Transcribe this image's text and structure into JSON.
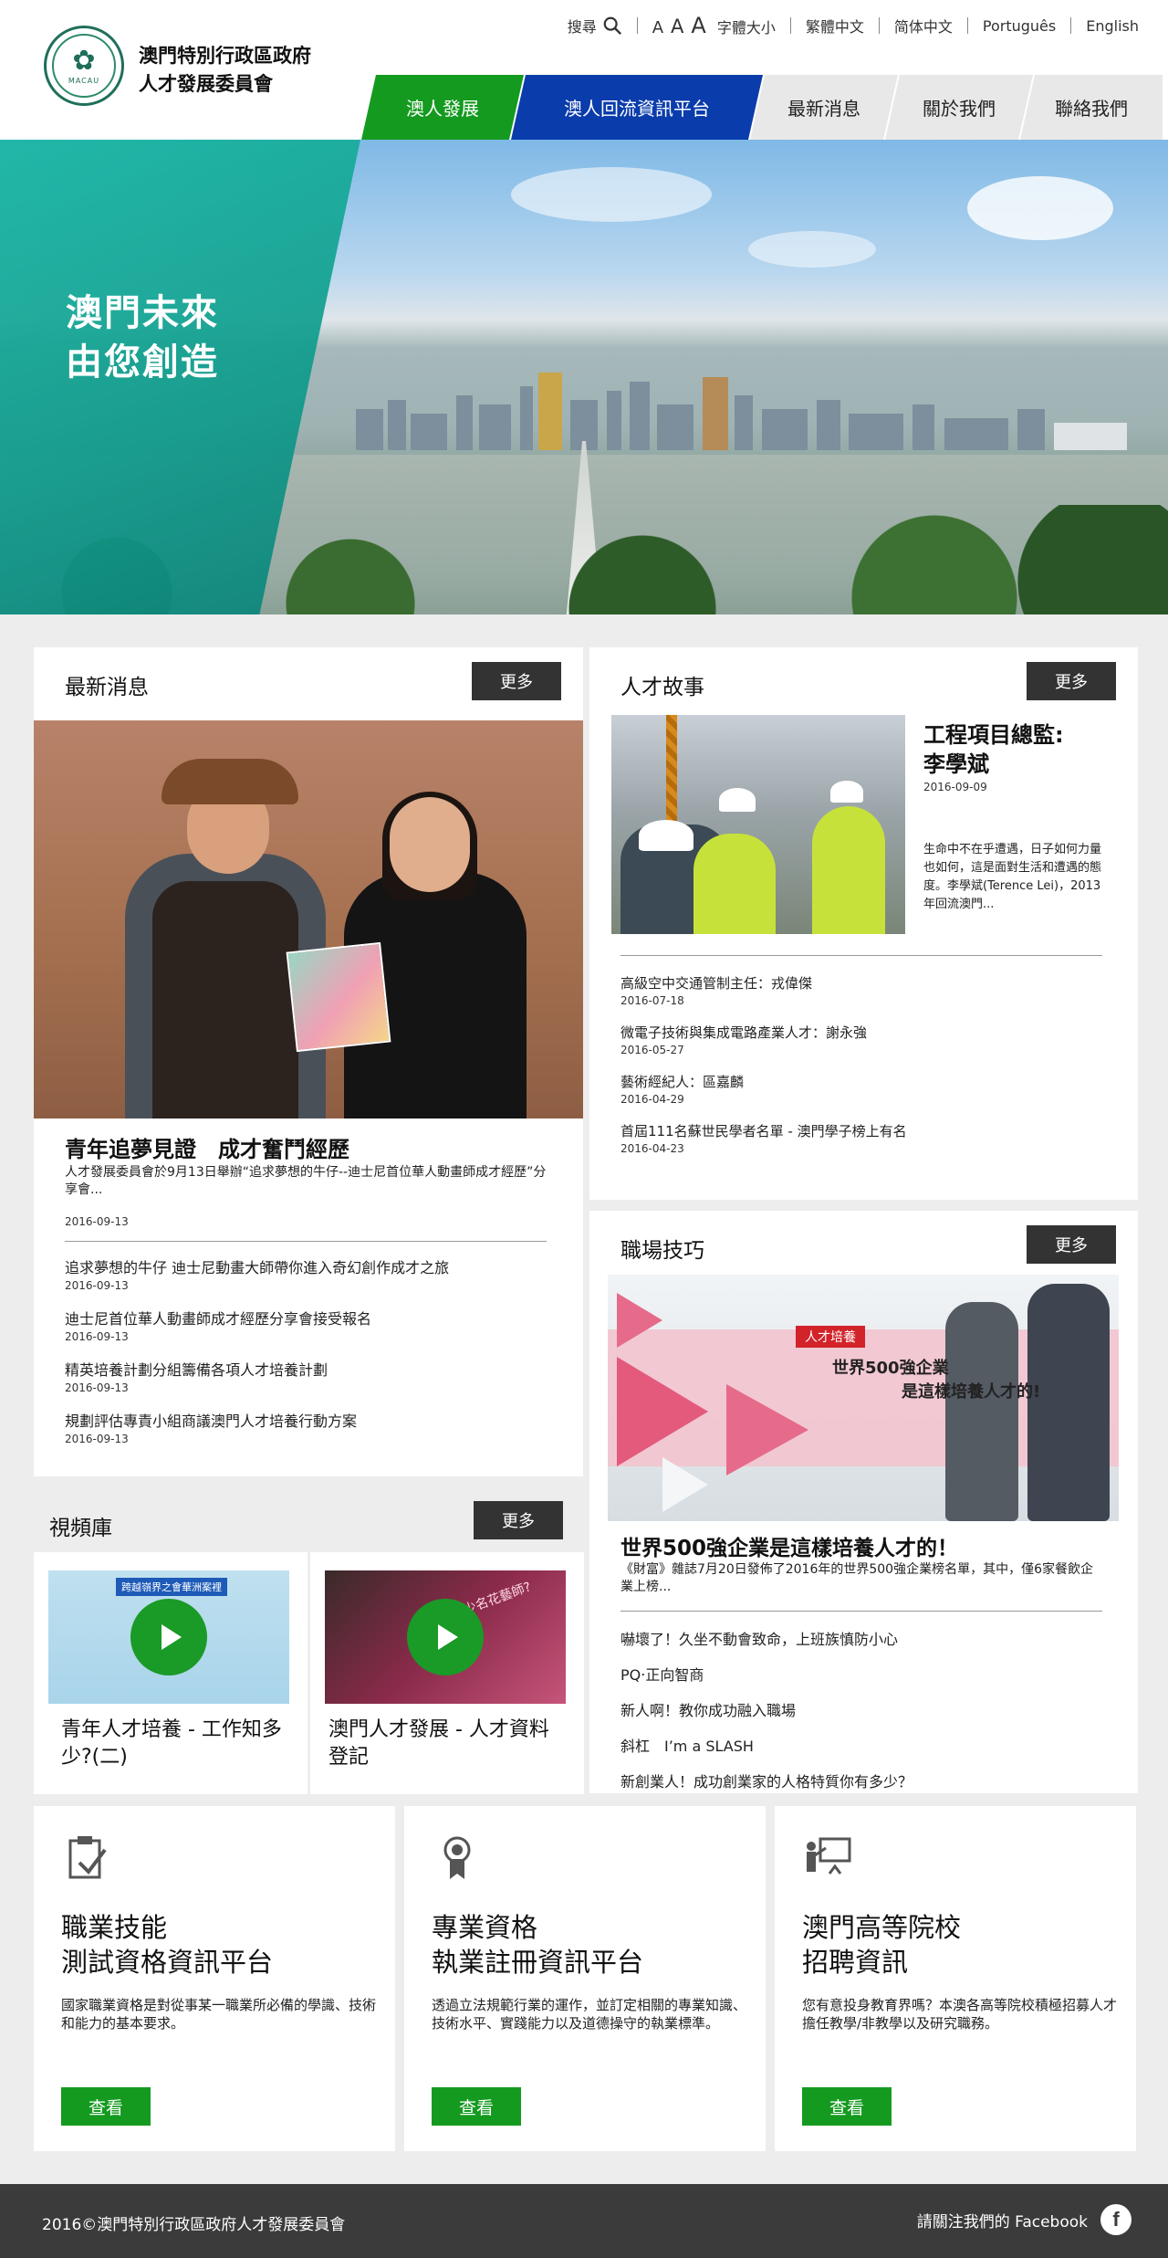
{
  "header": {
    "org_line1": "澳門特別行政區政府",
    "org_line2": "人才發展委員會",
    "logo_text": "MACAU",
    "search_label": "搜尋",
    "font_a1": "A",
    "font_a2": "A",
    "font_a3": "A",
    "font_size_label": "字體大小",
    "lang_trad": "繁體中文",
    "lang_simp": "简体中文",
    "lang_pt": "Português",
    "lang_en": "English",
    "nav": [
      "澳人發展",
      "澳人回流資訊平台",
      "最新消息",
      "關於我們",
      "聯絡我們"
    ]
  },
  "hero": {
    "line1": "澳門未來",
    "line2": "由您創造"
  },
  "news": {
    "title": "最新消息",
    "more": "更多",
    "headline_title": "青年追夢見證　成才奮鬥經歷",
    "headline_desc": "人才發展委員會於9月13日舉辦“追求夢想的牛仔--迪士尼首位華人動畫師成才經歷”分享會...",
    "headline_date": "2016-09-13",
    "items": [
      {
        "title": "追求夢想的牛仔 迪士尼動畫大師帶你進入奇幻創作成才之旅",
        "date": "2016-09-13"
      },
      {
        "title": "迪士尼首位華人動畫師成才經歷分享會接受報名",
        "date": "2016-09-13"
      },
      {
        "title": "精英培養計劃分組籌備各項人才培養計劃",
        "date": "2016-09-13"
      },
      {
        "title": "規劃評估專責小組商議澳門人才培養行動方案",
        "date": "2016-09-13"
      }
    ]
  },
  "stories": {
    "title": "人才故事",
    "more": "更多",
    "feature_name_1": "工程項目總監:",
    "feature_name_2": "李學斌",
    "feature_date": "2016-09-09",
    "feature_desc": "生命中不在乎遭遇，日子如何力量也如何，這是面對生活和遭遇的態度。李學斌(Terence Lei)，2013年回流澳門...",
    "items": [
      {
        "title": "高級空中交通管制主任：戎偉傑",
        "date": "2016-07-18"
      },
      {
        "title": "微電子技術與集成電路產業人才：謝永強",
        "date": "2016-05-27"
      },
      {
        "title": "藝術經紀人：區嘉麟",
        "date": "2016-04-29"
      },
      {
        "title": "首屆111名蘇世民學者名單 - 澳門學子榜上有名",
        "date": "2016-04-23"
      }
    ]
  },
  "skills": {
    "title": "職場技巧",
    "more": "更多",
    "banner_tag": "人才培養",
    "banner_line1": "世界500強企業",
    "banner_line2": "是這樣培養人才的!",
    "headline_title": "世界500強企業是這樣培養人才的！",
    "headline_desc": "《財富》雜誌7月20日發佈了2016年的世界500強企業榜名單，其中，僅6家餐飲企業上榜...",
    "items": [
      "嚇壞了！久坐不動會致命，上班族慎防小心",
      "PQ‧正向智商",
      "新人啊！教你成功融入職場",
      "斜杠　I’m a SLASH",
      "新創業人！成功創業家的人格特質你有多少？"
    ]
  },
  "videos": {
    "title": "視頻庫",
    "more": "更多",
    "items": [
      {
        "caption": "青年人才培養 - 工作知多少?(二)",
        "thumb_text": "跨越嶺界之會華洲案裡"
      },
      {
        "caption": "澳門人才發展 - 人才資料登記",
        "thumb_text": "少名花藝師?"
      }
    ]
  },
  "platforms": [
    {
      "title_1": "職業技能",
      "title_2": "測試資格資訊平台",
      "desc": "國家職業資格是對從事某一職業所必備的學識、技術和能力的基本要求。",
      "button": "查看",
      "icon": "clipboard-check-icon"
    },
    {
      "title_1": "專業資格",
      "title_2": "執業註冊資訊平台",
      "desc": "透過立法規範行業的運作，並訂定相關的專業知識、技術水平、實踐能力以及道德操守的執業標準。",
      "button": "查看",
      "icon": "award-badge-icon"
    },
    {
      "title_1": "澳門高等院校",
      "title_2": "招聘資訊",
      "desc": "您有意投身教育界嗎？本澳各高等院校積極招募人才擔任教學/非教學以及研究職務。",
      "button": "查看",
      "icon": "teacher-board-icon"
    }
  ],
  "footer": {
    "copyright": "2016©澳門特別行政區政府人才發展委員會",
    "facebook_label": "請關注我們的 Facebook",
    "facebook_icon_letter": "f"
  },
  "colors": {
    "green": "#159a20",
    "blue": "#0a3cac",
    "teal": "#14a898",
    "dark": "#333333"
  }
}
